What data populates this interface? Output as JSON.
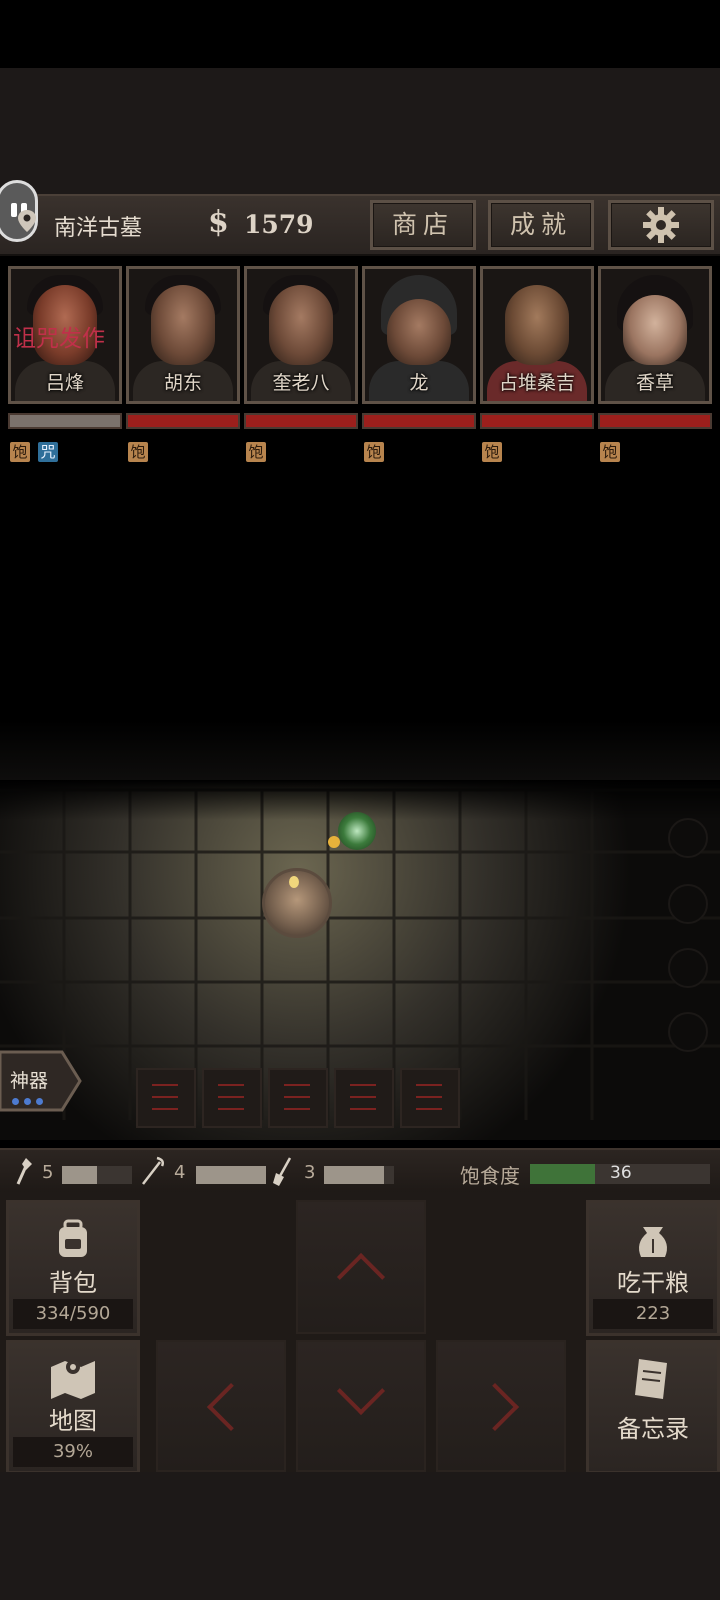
{
  "header": {
    "location": "南洋古墓",
    "money_symbol": "$",
    "money": "1579",
    "shop_label": "商店",
    "achievements_label": "成就"
  },
  "characters": [
    {
      "name": "吕烽",
      "status_text": "诅咒发作",
      "badges": [
        "饱",
        "咒"
      ],
      "hp_color": "grey"
    },
    {
      "name": "胡东",
      "badges": [
        "饱"
      ]
    },
    {
      "name": "奎老八",
      "badges": [
        "饱"
      ]
    },
    {
      "name": "龙",
      "badges": [
        "饱"
      ]
    },
    {
      "name": "占堆桑吉",
      "badges": [
        "饱"
      ]
    },
    {
      "name": "香草",
      "badges": [
        "饱"
      ]
    }
  ],
  "artifact": {
    "label": "神器"
  },
  "tools": [
    {
      "icon": "torch-icon",
      "count": "5",
      "level": 0.5
    },
    {
      "icon": "rope-hook-icon",
      "count": "4",
      "level": 1.0
    },
    {
      "icon": "shovel-icon",
      "count": "3",
      "level": 0.85
    }
  ],
  "satiety": {
    "label": "饱食度",
    "value": "36",
    "level": 0.36
  },
  "controls": {
    "backpack": {
      "label": "背包",
      "sub": "334/590"
    },
    "eat": {
      "label": "吃干粮",
      "sub": "223"
    },
    "map": {
      "label": "地图",
      "sub": "39%"
    },
    "memo": {
      "label": "备忘录"
    }
  },
  "colors": {
    "accent_red": "#9c1f1c",
    "satiety_green": "#3f7339",
    "badge_full": "#b7844e",
    "badge_curse": "#2f6f9a",
    "curse_text": "#c0304a"
  }
}
